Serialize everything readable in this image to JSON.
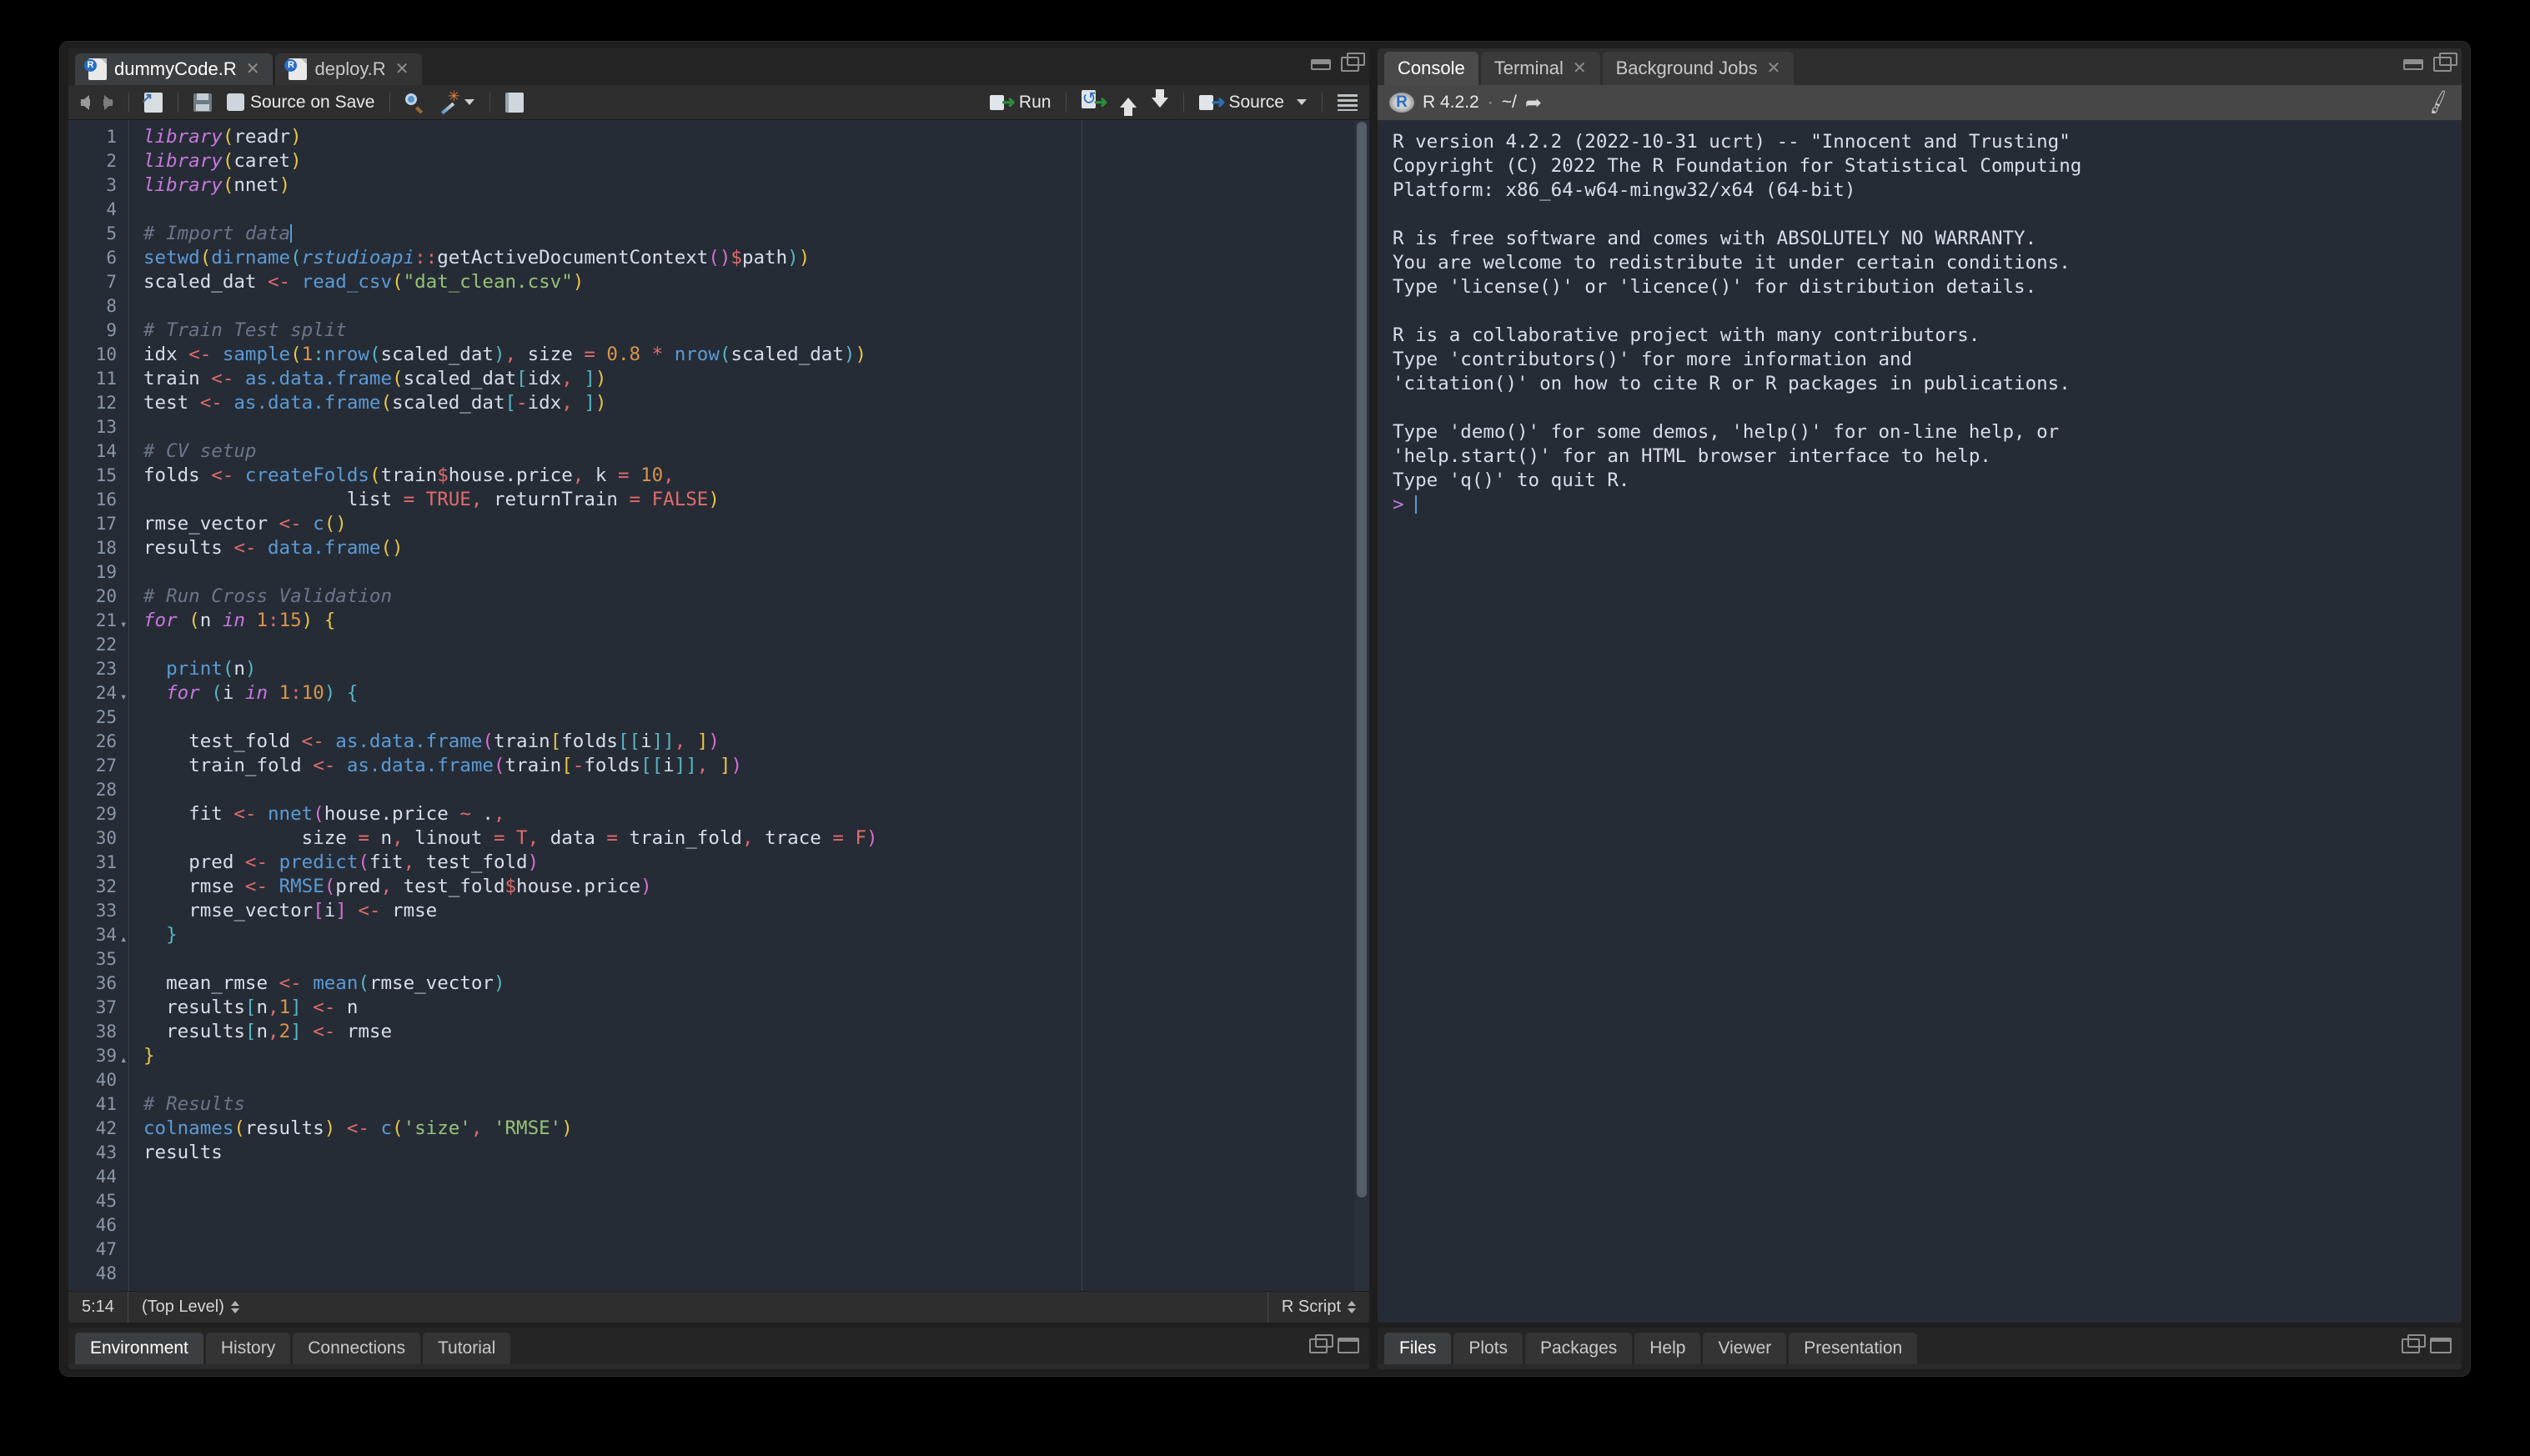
{
  "editor": {
    "tabs": [
      {
        "label": "dummyCode.R",
        "icon": "r-file-icon",
        "active": true,
        "closable": true
      },
      {
        "label": "deploy.R",
        "icon": "r-file-icon",
        "active": false,
        "closable": true
      }
    ],
    "toolbar": {
      "back": "back-arrow",
      "forward": "forward-arrow",
      "new_doc": "popout-document",
      "save": "save-icon",
      "source_on_save_label": "Source on Save",
      "find": "search-icon",
      "magic": "code-tools-wand",
      "compile_report": "compile-report",
      "run_label": "Run",
      "rerun": "rerun-icon",
      "prev_chunk": "up-arrow",
      "next_chunk": "down-arrow",
      "source_label": "Source",
      "outline": "document-outline"
    },
    "status": {
      "position": "5:14",
      "scope": "(Top Level)",
      "filetype": "R Script"
    },
    "code": [
      {
        "n": 1,
        "fold": "",
        "html": "<span class=\"s-key\">library</span><span class=\"s-b1\">(</span><span class=\"s-id\">readr</span><span class=\"s-b1\">)</span>"
      },
      {
        "n": 2,
        "fold": "",
        "html": "<span class=\"s-key\">library</span><span class=\"s-b1\">(</span><span class=\"s-id\">caret</span><span class=\"s-b1\">)</span>"
      },
      {
        "n": 3,
        "fold": "",
        "html": "<span class=\"s-key\">library</span><span class=\"s-b1\">(</span><span class=\"s-id\">nnet</span><span class=\"s-b1\">)</span>"
      },
      {
        "n": 4,
        "fold": "",
        "html": ""
      },
      {
        "n": 5,
        "fold": "",
        "html": "<span class=\"s-com\"># Import data</span><span class=\"cursor-bar\"></span>"
      },
      {
        "n": 6,
        "fold": "",
        "html": "<span class=\"s-fn\">setwd</span><span class=\"s-b1\">(</span><span class=\"s-fn\">dirname</span><span class=\"s-b2\">(</span><span class=\"s-ns\">rstudioapi</span><span class=\"s-op\">::</span><span class=\"s-id\">getActiveDocumentContext</span><span class=\"s-b3\">(</span><span class=\"s-b3\">)</span><span class=\"s-op\">$</span><span class=\"s-id\">path</span><span class=\"s-b2\">)</span><span class=\"s-b1\">)</span>"
      },
      {
        "n": 7,
        "fold": "",
        "html": "<span class=\"s-id\">scaled_dat</span> <span class=\"s-op\">&lt;-</span> <span class=\"s-fn\">read_csv</span><span class=\"s-b1\">(</span><span class=\"s-str\">\"dat_clean.csv\"</span><span class=\"s-b1\">)</span>"
      },
      {
        "n": 8,
        "fold": "",
        "html": ""
      },
      {
        "n": 9,
        "fold": "",
        "html": "<span class=\"s-com\"># Train Test split</span>"
      },
      {
        "n": 10,
        "fold": "",
        "html": "<span class=\"s-id\">idx</span> <span class=\"s-op\">&lt;-</span> <span class=\"s-fn\">sample</span><span class=\"s-b1\">(</span><span class=\"s-num\">1</span><span class=\"s-b2\">:</span><span class=\"s-fn\">nrow</span><span class=\"s-b2\">(</span><span class=\"s-id\">scaled_dat</span><span class=\"s-b2\">)</span><span class=\"s-op\">,</span> <span class=\"s-id\">size</span> <span class=\"s-op\">=</span> <span class=\"s-num\">0.8</span> <span class=\"s-op\">*</span> <span class=\"s-fn\">nrow</span><span class=\"s-b2\">(</span><span class=\"s-id\">scaled_dat</span><span class=\"s-b2\">)</span><span class=\"s-b1\">)</span>"
      },
      {
        "n": 11,
        "fold": "",
        "html": "<span class=\"s-id\">train</span> <span class=\"s-op\">&lt;-</span> <span class=\"s-fn\">as.data.frame</span><span class=\"s-b1\">(</span><span class=\"s-id\">scaled_dat</span><span class=\"s-b2\">[</span><span class=\"s-id\">idx</span><span class=\"s-op\">,</span> <span class=\"s-b2\">]</span><span class=\"s-b1\">)</span>"
      },
      {
        "n": 12,
        "fold": "",
        "html": "<span class=\"s-id\">test</span> <span class=\"s-op\">&lt;-</span> <span class=\"s-fn\">as.data.frame</span><span class=\"s-b1\">(</span><span class=\"s-id\">scaled_dat</span><span class=\"s-b2\">[</span><span class=\"s-op\">-</span><span class=\"s-id\">idx</span><span class=\"s-op\">,</span> <span class=\"s-b2\">]</span><span class=\"s-b1\">)</span>"
      },
      {
        "n": 13,
        "fold": "",
        "html": ""
      },
      {
        "n": 14,
        "fold": "",
        "html": "<span class=\"s-com\"># CV setup</span>"
      },
      {
        "n": 15,
        "fold": "",
        "html": "<span class=\"s-id\">folds</span> <span class=\"s-op\">&lt;-</span> <span class=\"s-fn\">createFolds</span><span class=\"s-b1\">(</span><span class=\"s-id\">train</span><span class=\"s-op\">$</span><span class=\"s-id\">house.price</span><span class=\"s-op\">,</span> <span class=\"s-id\">k</span> <span class=\"s-op\">=</span> <span class=\"s-num\">10</span><span class=\"s-op\">,</span>"
      },
      {
        "n": 16,
        "fold": "",
        "html": "                  <span class=\"s-id\">list</span> <span class=\"s-op\">=</span> <span class=\"s-const\">TRUE</span><span class=\"s-op\">,</span> <span class=\"s-id\">returnTrain</span> <span class=\"s-op\">=</span> <span class=\"s-const\">FALSE</span><span class=\"s-b1\">)</span>"
      },
      {
        "n": 17,
        "fold": "",
        "html": "<span class=\"s-id\">rmse_vector</span> <span class=\"s-op\">&lt;-</span> <span class=\"s-fn\">c</span><span class=\"s-b1\">(</span><span class=\"s-b1\">)</span>"
      },
      {
        "n": 18,
        "fold": "",
        "html": "<span class=\"s-id\">results</span> <span class=\"s-op\">&lt;-</span> <span class=\"s-fn\">data.frame</span><span class=\"s-b1\">(</span><span class=\"s-b1\">)</span>"
      },
      {
        "n": 19,
        "fold": "",
        "html": ""
      },
      {
        "n": 20,
        "fold": "",
        "html": "<span class=\"s-com\"># Run Cross Validation</span>"
      },
      {
        "n": 21,
        "fold": "down",
        "html": "<span class=\"s-key\">for</span> <span class=\"s-b1\">(</span><span class=\"s-id\">n</span> <span class=\"s-key\">in</span> <span class=\"s-num\">1</span><span class=\"s-op\">:</span><span class=\"s-num\">15</span><span class=\"s-b1\">)</span> <span class=\"s-b1\">{</span>"
      },
      {
        "n": 22,
        "fold": "",
        "html": ""
      },
      {
        "n": 23,
        "fold": "",
        "html": "  <span class=\"s-fn\">print</span><span class=\"s-b2\">(</span><span class=\"s-id\">n</span><span class=\"s-b2\">)</span>"
      },
      {
        "n": 24,
        "fold": "down",
        "html": "  <span class=\"s-key\">for</span> <span class=\"s-b2\">(</span><span class=\"s-id\">i</span> <span class=\"s-key\">in</span> <span class=\"s-num\">1</span><span class=\"s-op\">:</span><span class=\"s-num\">10</span><span class=\"s-b2\">)</span> <span class=\"s-b2\">{</span>"
      },
      {
        "n": 25,
        "fold": "",
        "html": ""
      },
      {
        "n": 26,
        "fold": "",
        "html": "    <span class=\"s-id\">test_fold</span> <span class=\"s-op\">&lt;-</span> <span class=\"s-fn\">as.data.frame</span><span class=\"s-b3\">(</span><span class=\"s-id\">train</span><span class=\"s-b1\">[</span><span class=\"s-id\">folds</span><span class=\"s-b2\">[[</span><span class=\"s-id\">i</span><span class=\"s-b2\">]]</span><span class=\"s-op\">,</span> <span class=\"s-b1\">]</span><span class=\"s-b3\">)</span>"
      },
      {
        "n": 27,
        "fold": "",
        "html": "    <span class=\"s-id\">train_fold</span> <span class=\"s-op\">&lt;-</span> <span class=\"s-fn\">as.data.frame</span><span class=\"s-b3\">(</span><span class=\"s-id\">train</span><span class=\"s-b1\">[</span><span class=\"s-op\">-</span><span class=\"s-id\">folds</span><span class=\"s-b2\">[[</span><span class=\"s-id\">i</span><span class=\"s-b2\">]]</span><span class=\"s-op\">,</span> <span class=\"s-b1\">]</span><span class=\"s-b3\">)</span>"
      },
      {
        "n": 28,
        "fold": "",
        "html": ""
      },
      {
        "n": 29,
        "fold": "",
        "html": "    <span class=\"s-id\">fit</span> <span class=\"s-op\">&lt;-</span> <span class=\"s-fn\">nnet</span><span class=\"s-b3\">(</span><span class=\"s-id\">house.price</span> <span class=\"s-op\">~</span> <span class=\"s-id\">.</span><span class=\"s-op\">,</span>"
      },
      {
        "n": 30,
        "fold": "",
        "html": "              <span class=\"s-id\">size</span> <span class=\"s-op\">=</span> <span class=\"s-id\">n</span><span class=\"s-op\">,</span> <span class=\"s-id\">linout</span> <span class=\"s-op\">=</span> <span class=\"s-const\">T</span><span class=\"s-op\">,</span> <span class=\"s-id\">data</span> <span class=\"s-op\">=</span> <span class=\"s-id\">train_fold</span><span class=\"s-op\">,</span> <span class=\"s-id\">trace</span> <span class=\"s-op\">=</span> <span class=\"s-const\">F</span><span class=\"s-b3\">)</span>"
      },
      {
        "n": 31,
        "fold": "",
        "html": "    <span class=\"s-id\">pred</span> <span class=\"s-op\">&lt;-</span> <span class=\"s-fn\">predict</span><span class=\"s-b3\">(</span><span class=\"s-id\">fit</span><span class=\"s-op\">,</span> <span class=\"s-id\">test_fold</span><span class=\"s-b3\">)</span>"
      },
      {
        "n": 32,
        "fold": "",
        "html": "    <span class=\"s-id\">rmse</span> <span class=\"s-op\">&lt;-</span> <span class=\"s-fn\">RMSE</span><span class=\"s-b3\">(</span><span class=\"s-id\">pred</span><span class=\"s-op\">,</span> <span class=\"s-id\">test_fold</span><span class=\"s-op\">$</span><span class=\"s-id\">house.price</span><span class=\"s-b3\">)</span>"
      },
      {
        "n": 33,
        "fold": "",
        "html": "    <span class=\"s-id\">rmse_vector</span><span class=\"s-b3\">[</span><span class=\"s-id\">i</span><span class=\"s-b3\">]</span> <span class=\"s-op\">&lt;-</span> <span class=\"s-id\">rmse</span>"
      },
      {
        "n": 34,
        "fold": "up",
        "html": "  <span class=\"s-b2\">}</span>"
      },
      {
        "n": 35,
        "fold": "",
        "html": ""
      },
      {
        "n": 36,
        "fold": "",
        "html": "  <span class=\"s-id\">mean_rmse</span> <span class=\"s-op\">&lt;-</span> <span class=\"s-fn\">mean</span><span class=\"s-b2\">(</span><span class=\"s-id\">rmse_vector</span><span class=\"s-b2\">)</span>"
      },
      {
        "n": 37,
        "fold": "",
        "html": "  <span class=\"s-id\">results</span><span class=\"s-b2\">[</span><span class=\"s-id\">n</span><span class=\"s-op\">,</span><span class=\"s-num\">1</span><span class=\"s-b2\">]</span> <span class=\"s-op\">&lt;-</span> <span class=\"s-id\">n</span>"
      },
      {
        "n": 38,
        "fold": "",
        "html": "  <span class=\"s-id\">results</span><span class=\"s-b2\">[</span><span class=\"s-id\">n</span><span class=\"s-op\">,</span><span class=\"s-num\">2</span><span class=\"s-b2\">]</span> <span class=\"s-op\">&lt;-</span> <span class=\"s-id\">rmse</span>"
      },
      {
        "n": 39,
        "fold": "up",
        "html": "<span class=\"s-b1\">}</span>"
      },
      {
        "n": 40,
        "fold": "",
        "html": ""
      },
      {
        "n": 41,
        "fold": "",
        "html": "<span class=\"s-com\"># Results</span>"
      },
      {
        "n": 42,
        "fold": "",
        "html": "<span class=\"s-fn\">colnames</span><span class=\"s-b1\">(</span><span class=\"s-id\">results</span><span class=\"s-b1\">)</span> <span class=\"s-op\">&lt;-</span> <span class=\"s-fn\">c</span><span class=\"s-b1\">(</span><span class=\"s-str\">'size'</span><span class=\"s-op\">,</span> <span class=\"s-str\">'RMSE'</span><span class=\"s-b1\">)</span>"
      },
      {
        "n": 43,
        "fold": "",
        "html": "<span class=\"s-id\">results</span>"
      },
      {
        "n": 44,
        "fold": "",
        "html": ""
      },
      {
        "n": 45,
        "fold": "",
        "html": ""
      },
      {
        "n": 46,
        "fold": "",
        "html": ""
      },
      {
        "n": 47,
        "fold": "",
        "html": ""
      },
      {
        "n": 48,
        "fold": "",
        "html": ""
      }
    ]
  },
  "console": {
    "tabs": [
      {
        "label": "Console",
        "active": true,
        "closable": false
      },
      {
        "label": "Terminal",
        "active": false,
        "closable": true
      },
      {
        "label": "Background Jobs",
        "active": false,
        "closable": true
      }
    ],
    "header": {
      "version": "R 4.2.2",
      "separator": "·",
      "working_dir": "~/",
      "popout_icon": "popout-arrow-icon",
      "clear_icon": "broom-icon"
    },
    "output": "R version 4.2.2 (2022-10-31 ucrt) -- \"Innocent and Trusting\"\nCopyright (C) 2022 The R Foundation for Statistical Computing\nPlatform: x86_64-w64-mingw32/x64 (64-bit)\n\nR is free software and comes with ABSOLUTELY NO WARRANTY.\nYou are welcome to redistribute it under certain conditions.\nType 'license()' or 'licence()' for distribution details.\n\nR is a collaborative project with many contributors.\nType 'contributors()' for more information and\n'citation()' on how to cite R or R packages in publications.\n\nType 'demo()' for some demos, 'help()' for on-line help, or\n'help.start()' for an HTML browser interface to help.\nType 'q()' to quit R.\n",
    "prompt": ">"
  },
  "bottom_left": {
    "tabs": [
      {
        "label": "Environment",
        "active": true
      },
      {
        "label": "History",
        "active": false
      },
      {
        "label": "Connections",
        "active": false
      },
      {
        "label": "Tutorial",
        "active": false
      }
    ]
  },
  "bottom_right": {
    "tabs": [
      {
        "label": "Files",
        "active": true
      },
      {
        "label": "Plots",
        "active": false
      },
      {
        "label": "Packages",
        "active": false
      },
      {
        "label": "Help",
        "active": false
      },
      {
        "label": "Viewer",
        "active": false
      },
      {
        "label": "Presentation",
        "active": false
      }
    ]
  },
  "theme": {
    "editor_bg": "#262c36",
    "chrome_bg": "#2b2b2b",
    "accent_blue": "#5b9bd5",
    "string_green": "#97c279",
    "keyword_purple": "#c678dd",
    "number_orange": "#d9944a",
    "operator_red": "#e06c6c"
  }
}
